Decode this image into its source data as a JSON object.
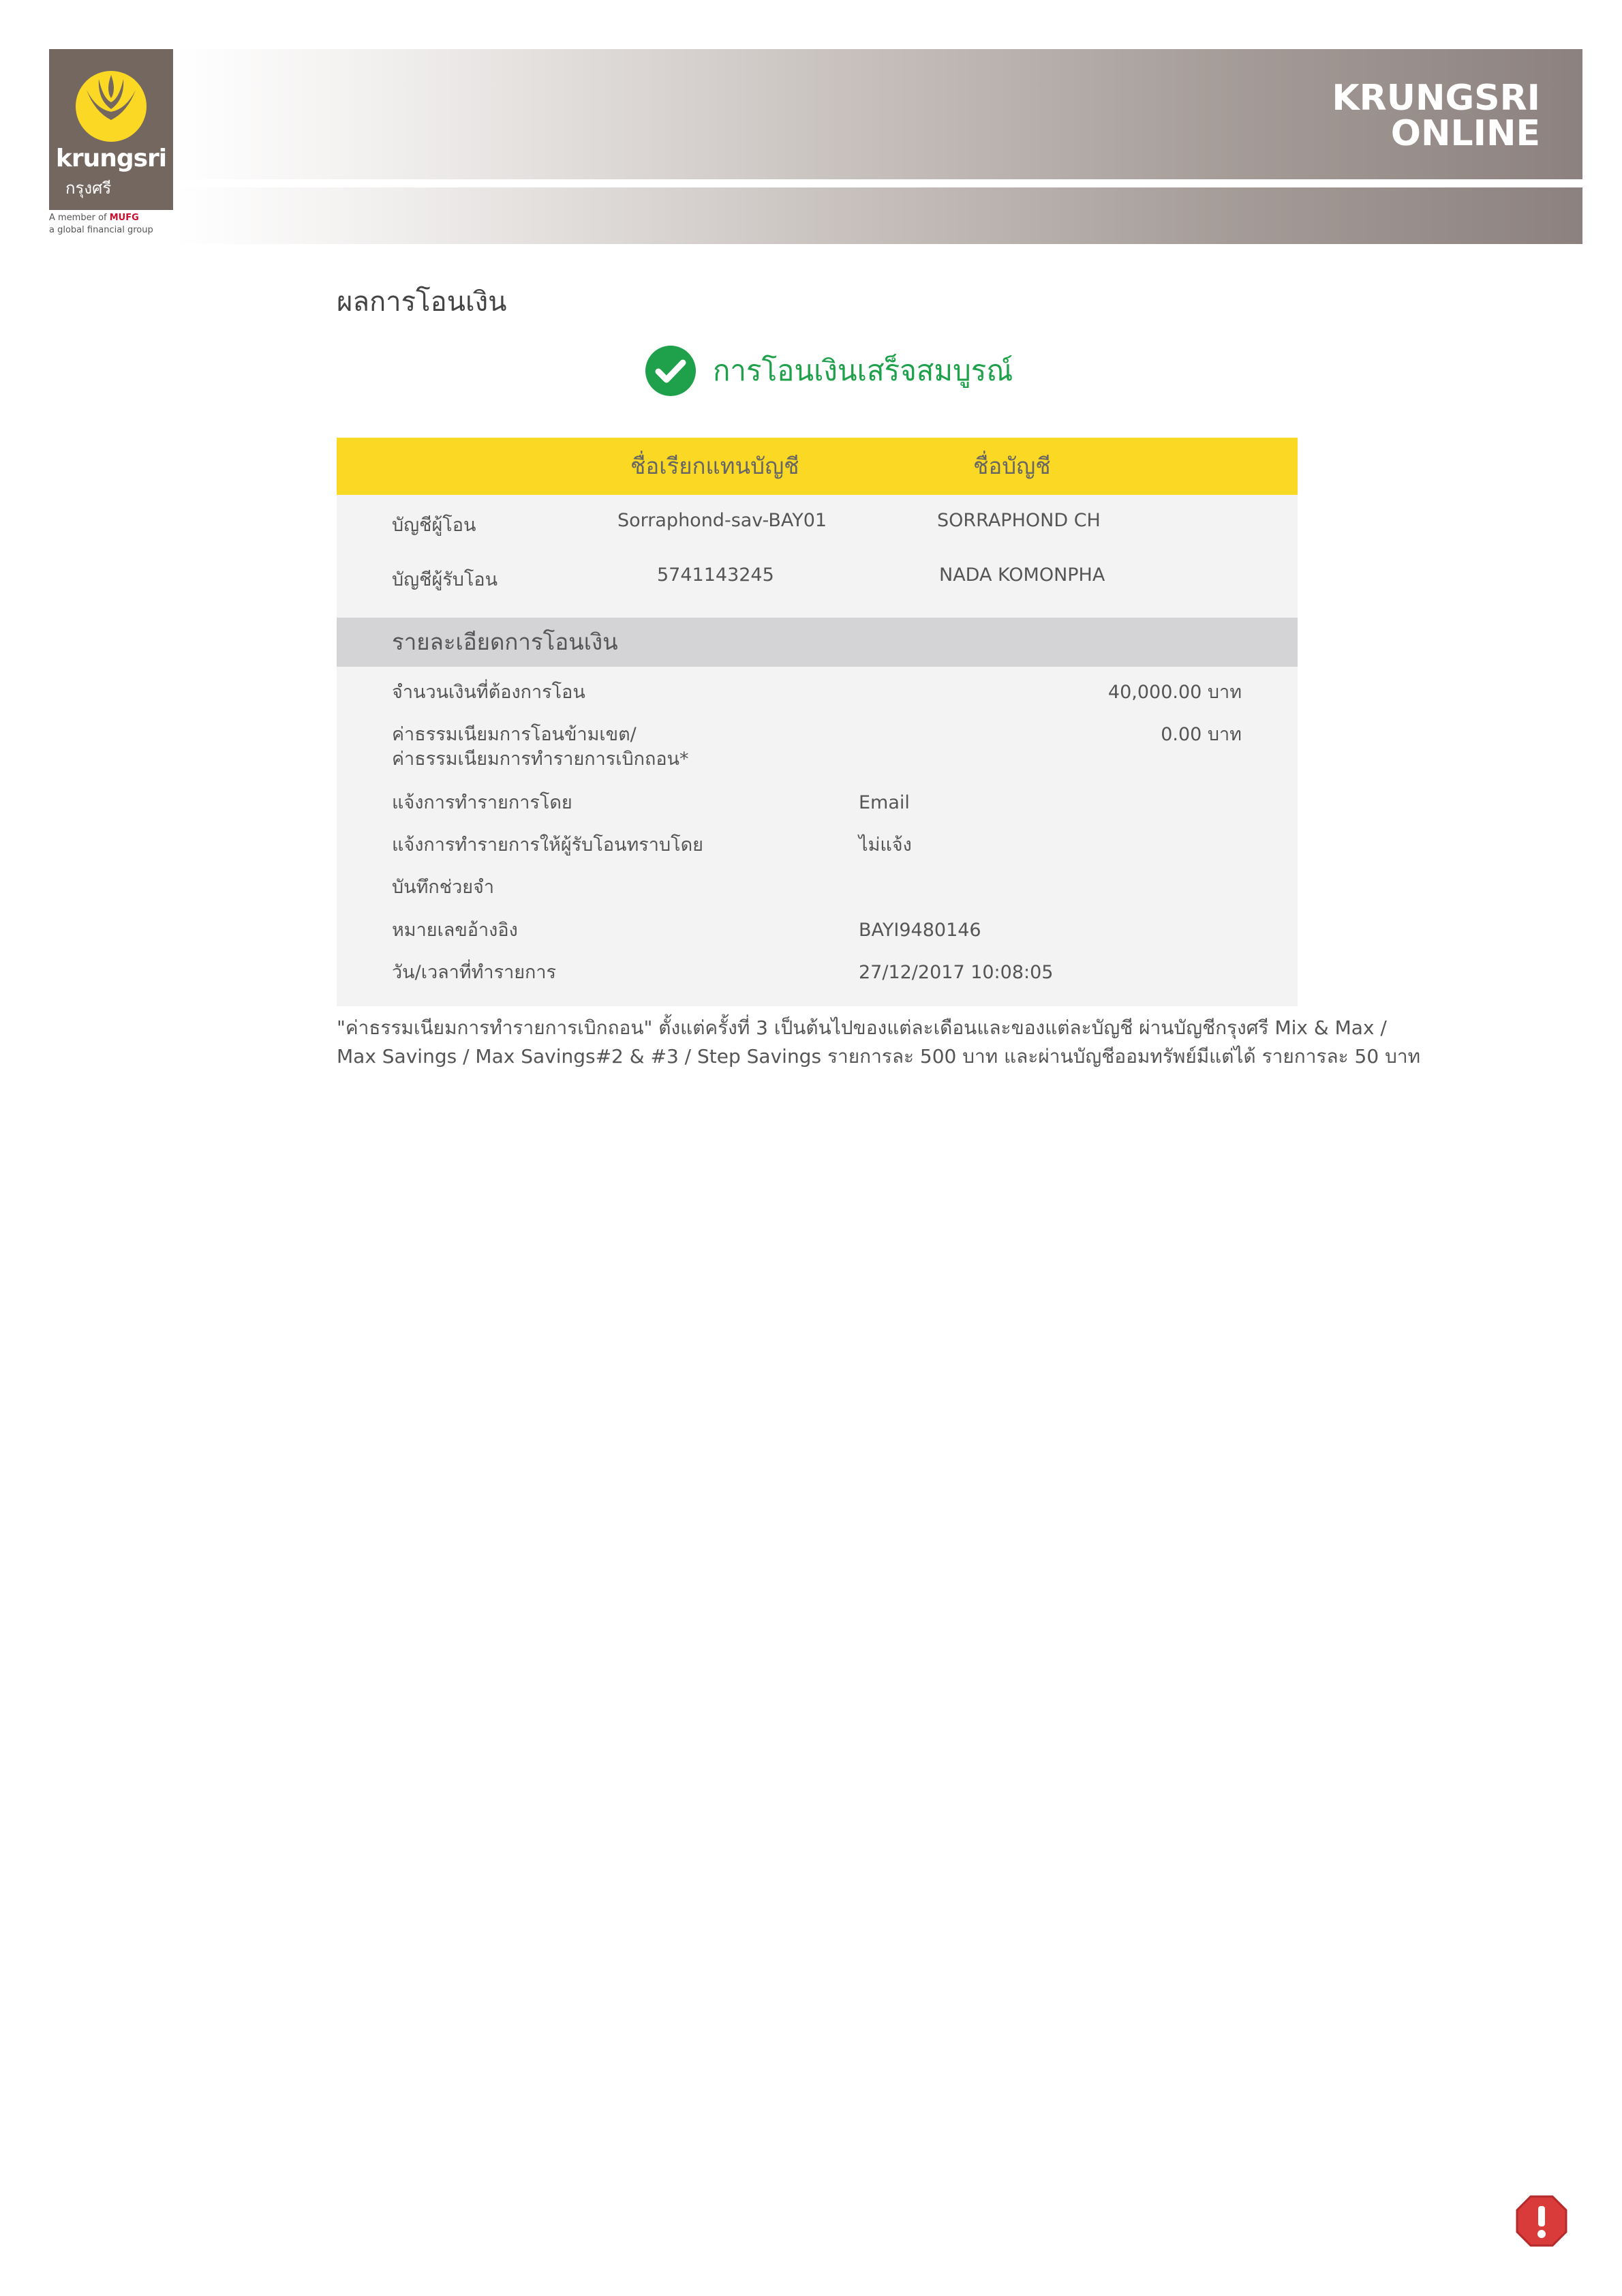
{
  "header": {
    "logo_en": "krungsri",
    "logo_th": "กรุงศรี",
    "member_line_prefix": "A member of",
    "member_brand": "MUFG",
    "member_line2": "a global financial group",
    "brand_line1": "KRUNGSRI",
    "brand_line2": "ONLINE"
  },
  "page_title": "ผลการโอนเงิน",
  "success_message": "การโอนเงินเสร็จสมบูรณ์",
  "accounts": {
    "col_nickname": "ชื่อเรียกแทนบัญชี",
    "col_name": "ชื่อบัญชี",
    "rows": [
      {
        "label": "บัญชีผู้โอน",
        "nickname": "Sorraphond-sav-BAY01",
        "name": "SORRAPHOND CH"
      },
      {
        "label": "บัญชีผู้รับโอน",
        "nickname": "5741143245",
        "name": "NADA KOMONPHA"
      }
    ]
  },
  "details": {
    "section_title": "รายละเอียดการโอนเงิน",
    "amount_label": "จำนวนเงินที่ต้องการโอน",
    "amount_value": "40,000.00 บาท",
    "fee_label_line1": "ค่าธรรมเนียมการโอนข้ามเขต/",
    "fee_label_line2": "ค่าธรรมเนียมการทำรายการเบิกถอน*",
    "fee_value": "0.00 บาท",
    "notify_label": "แจ้งการทำรายการโดย",
    "notify_value": "Email",
    "notify_recipient_label": "แจ้งการทำรายการให้ผู้รับโอนทราบโดย",
    "notify_recipient_value": "ไม่แจ้ง",
    "memo_label": "บันทึกช่วยจำ",
    "reference_label": "หมายเลขอ้างอิง",
    "reference_value": "BAYI9480146",
    "datetime_label": "วัน/เวลาที่ทำรายการ",
    "datetime_value": "27/12/2017 10:08:05"
  },
  "footnote": {
    "line1": "\"ค่าธรรมเนียมการทำรายการเบิกถอน\" ตั้งแต่ครั้งที่ 3 เป็นต้นไปของแต่ละเดือนและของแต่ละบัญชี ผ่านบัญชีกรุงศรี Mix & Max /",
    "line2": "Max Savings / Max Savings#2 & #3 / Step Savings รายการละ 500 บาท และผ่านบัญชีออมทรัพย์มีแต่ได้ รายการละ 50 บาท"
  },
  "colors": {
    "accent_yellow": "#fbd823",
    "success_green": "#1ea14a",
    "logo_bg": "#74675f",
    "alert_red": "#d93a3a"
  },
  "icons": {
    "success": "check-circle-icon",
    "alert": "exclamation-octagon-icon",
    "logo": "krungsri-logo-icon"
  }
}
